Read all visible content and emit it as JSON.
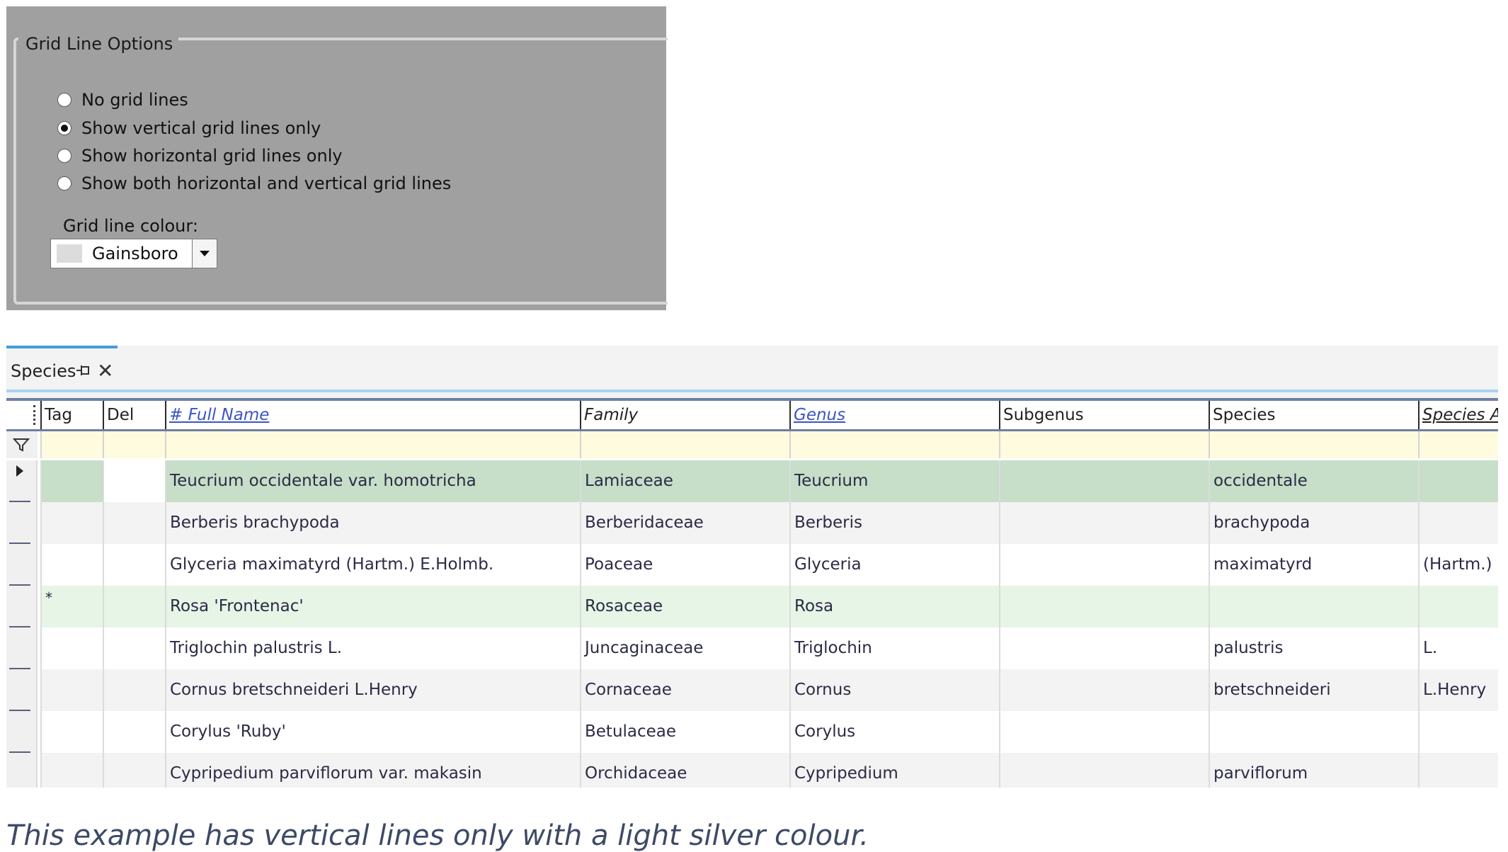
{
  "grid_options": {
    "legend": "Grid Line Options",
    "radio_options": [
      {
        "label": "No grid lines",
        "checked": false
      },
      {
        "label": "Show vertical grid lines only",
        "checked": true
      },
      {
        "label": "Show horizontal grid lines only",
        "checked": false
      },
      {
        "label": "Show both horizontal and vertical grid lines",
        "checked": false
      }
    ],
    "colour_label": "Grid line colour:",
    "colour_value": "Gainsboro",
    "colour_swatch": "#dcdcdc"
  },
  "species_panel": {
    "tab_title": "Species",
    "columns": [
      {
        "label": "Tag",
        "style": "plain"
      },
      {
        "label": "Del",
        "style": "plain"
      },
      {
        "label": "# Full Name",
        "style": "link"
      },
      {
        "label": "Family",
        "style": "italic"
      },
      {
        "label": "Genus",
        "style": "link"
      },
      {
        "label": "Subgenus",
        "style": "plain"
      },
      {
        "label": "Species",
        "style": "plain"
      },
      {
        "label": "Species Au",
        "style": "italic-underline"
      }
    ],
    "rows": [
      {
        "tag": "",
        "del": "",
        "full_name": "Teucrium occidentale var. homotricha",
        "family": "Lamiaceae",
        "genus": "Teucrium",
        "subgenus": "",
        "species": "occidentale",
        "author": "",
        "state": "selected"
      },
      {
        "tag": "",
        "del": "",
        "full_name": "Berberis brachypoda",
        "family": "Berberidaceae",
        "genus": "Berberis",
        "subgenus": "",
        "species": "brachypoda",
        "author": "",
        "state": "alt"
      },
      {
        "tag": "",
        "del": "",
        "full_name": "Glyceria maximatyrd (Hartm.) E.Holmb.",
        "family": "Poaceae",
        "genus": "Glyceria",
        "subgenus": "",
        "species": "maximatyrd",
        "author": "(Hartm.) E",
        "state": "normal"
      },
      {
        "tag": "*",
        "del": "",
        "full_name": "Rosa 'Frontenac'",
        "family": "Rosaceae",
        "genus": "Rosa",
        "subgenus": "",
        "species": "",
        "author": "",
        "state": "tagged"
      },
      {
        "tag": "",
        "del": "",
        "full_name": "Triglochin palustris L.",
        "family": "Juncaginaceae",
        "genus": "Triglochin",
        "subgenus": "",
        "species": "palustris",
        "author": "L.",
        "state": "normal"
      },
      {
        "tag": "",
        "del": "",
        "full_name": "Cornus bretschneideri L.Henry",
        "family": "Cornaceae",
        "genus": "Cornus",
        "subgenus": "",
        "species": "bretschneideri",
        "author": "L.Henry",
        "state": "alt"
      },
      {
        "tag": "",
        "del": "",
        "full_name": "Corylus 'Ruby'",
        "family": "Betulaceae",
        "genus": "Corylus",
        "subgenus": "",
        "species": "",
        "author": "",
        "state": "normal"
      },
      {
        "tag": "",
        "del": "",
        "full_name": "Cypripedium parviflorum var. makasin",
        "family": "Orchidaceae",
        "genus": "Cypripedium",
        "subgenus": "",
        "species": "parviflorum",
        "author": "",
        "state": "alt"
      }
    ],
    "colors": {
      "selected": "#c7dec8",
      "tagged": "#e6f5e6",
      "alt": "#f3f3f3",
      "normal": "#ffffff",
      "filter": "#fffbdf"
    }
  },
  "caption": "This example has vertical lines only with a light silver colour."
}
